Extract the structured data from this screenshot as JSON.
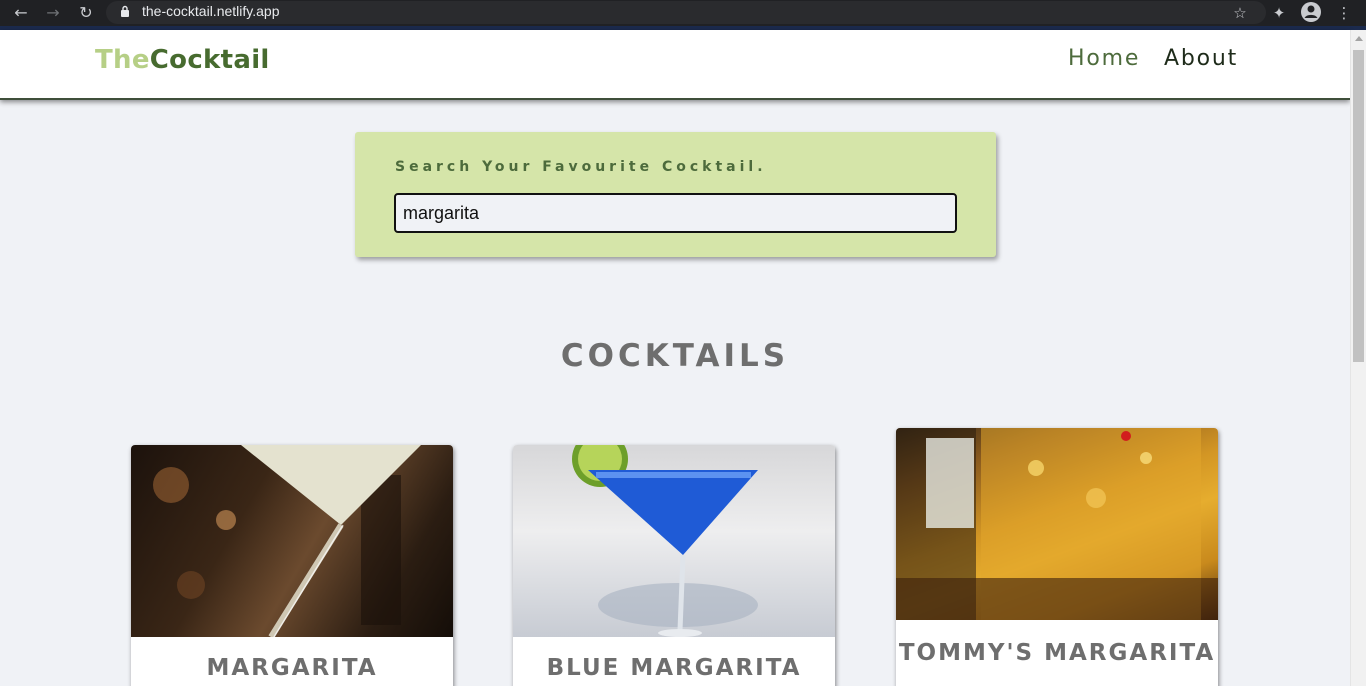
{
  "browser": {
    "url": "the-cocktail.netlify.app"
  },
  "navbar": {
    "logo_the": "The",
    "logo_cocktail": "Cocktail",
    "links": [
      {
        "label": "Home"
      },
      {
        "label": "About"
      }
    ]
  },
  "search": {
    "label": "Search Your Favourite Cocktail.",
    "value": "margarita"
  },
  "section": {
    "title": "COCKTAILS"
  },
  "cocktails": [
    {
      "name": "MARGARITA"
    },
    {
      "name": "BLUE MARGARITA"
    },
    {
      "name": "TOMMY'S MARGARITA"
    }
  ],
  "colors": {
    "accent_green": "#476b2f",
    "light_green": "#b6cf86",
    "search_bg": "#d5e5a9",
    "page_bg": "#f0f2f6"
  }
}
